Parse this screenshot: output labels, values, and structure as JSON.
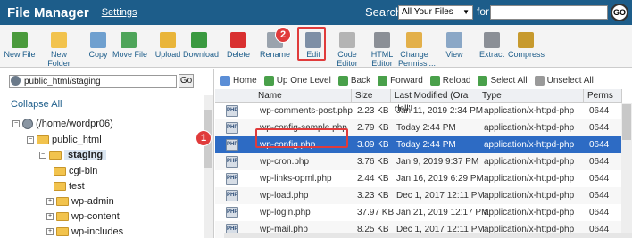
{
  "header": {
    "title": "File Manager",
    "settings": "Settings",
    "search_label": "Search",
    "search_scope": "All Your Files",
    "for_label": "for",
    "go": "GO"
  },
  "toolbar": [
    {
      "id": "new-file",
      "label": "New File",
      "color": "#4a9a3c"
    },
    {
      "id": "new-folder",
      "label": "New\nFolder",
      "color": "#f2c34d"
    },
    {
      "id": "copy",
      "label": "Copy",
      "color": "#6fa0cf"
    },
    {
      "id": "move-file",
      "label": "Move File",
      "color": "#4fa55a"
    },
    {
      "id": "upload",
      "label": "Upload",
      "color": "#e9b53a"
    },
    {
      "id": "download",
      "label": "Download",
      "color": "#3a9a40"
    },
    {
      "id": "delete",
      "label": "Delete",
      "color": "#d93030"
    },
    {
      "id": "rename",
      "label": "Rename",
      "color": "#9aa3ad"
    },
    {
      "id": "edit",
      "label": "Edit",
      "color": "#7e8fa6"
    },
    {
      "id": "code-editor",
      "label": "Code\nEditor",
      "color": "#b4b4b4"
    },
    {
      "id": "html-editor",
      "label": "HTML\nEditor",
      "color": "#8b8f96"
    },
    {
      "id": "change-permissions",
      "label": "Change\nPermissi...",
      "color": "#e3b04a"
    },
    {
      "id": "view",
      "label": "View",
      "color": "#8aa7c6"
    },
    {
      "id": "extract",
      "label": "Extract",
      "color": "#8b8f96"
    },
    {
      "id": "compress",
      "label": "Compress",
      "color": "#c79a2e"
    }
  ],
  "left": {
    "path": "public_html/staging",
    "go": "Go",
    "collapse_all": "Collapse All",
    "tree": [
      {
        "label": "(/home/wordpr06)",
        "toggle": "−"
      },
      {
        "label": "public_html",
        "toggle": "−"
      },
      {
        "label": "staging",
        "toggle": "−"
      },
      {
        "label": "cgi-bin",
        "toggle": ""
      },
      {
        "label": "test",
        "toggle": ""
      },
      {
        "label": "wp-admin",
        "toggle": "+"
      },
      {
        "label": "wp-content",
        "toggle": "+"
      },
      {
        "label": "wp-includes",
        "toggle": "+"
      }
    ]
  },
  "nav": [
    {
      "label": "Home",
      "color": "#5b8ed6"
    },
    {
      "label": "Up One Level",
      "color": "#49a04a"
    },
    {
      "label": "Back",
      "color": "#49a04a"
    },
    {
      "label": "Forward",
      "color": "#49a04a"
    },
    {
      "label": "Reload",
      "color": "#49a04a"
    },
    {
      "label": "Select All",
      "color": "#49a04a"
    },
    {
      "label": "Unselect All",
      "color": "#9a9a9a"
    }
  ],
  "columns": [
    "Name",
    "Size",
    "Last Modified (Ora dell'I",
    "Type",
    "Perms"
  ],
  "files": [
    {
      "name": "wp-comments-post.php",
      "size": "2.23 KB",
      "modified": "Jan 11, 2019 2:34 PM",
      "type": "application/x-httpd-php",
      "perms": "0644"
    },
    {
      "name": "wp-config-sample.php",
      "size": "2.79 KB",
      "modified": "Today 2:44 PM",
      "type": "application/x-httpd-php",
      "perms": "0644"
    },
    {
      "name": "wp-config.php",
      "size": "3.09 KB",
      "modified": "Today 2:44 PM",
      "type": "application/x-httpd-php",
      "perms": "0644"
    },
    {
      "name": "wp-cron.php",
      "size": "3.76 KB",
      "modified": "Jan 9, 2019 9:37 PM",
      "type": "application/x-httpd-php",
      "perms": "0644"
    },
    {
      "name": "wp-links-opml.php",
      "size": "2.44 KB",
      "modified": "Jan 16, 2019 6:29 PM",
      "type": "application/x-httpd-php",
      "perms": "0644"
    },
    {
      "name": "wp-load.php",
      "size": "3.23 KB",
      "modified": "Dec 1, 2017 12:11 PM",
      "type": "application/x-httpd-php",
      "perms": "0644"
    },
    {
      "name": "wp-login.php",
      "size": "37.97 KB",
      "modified": "Jan 21, 2019 12:17 PM",
      "type": "application/x-httpd-php",
      "perms": "0644"
    },
    {
      "name": "wp-mail.php",
      "size": "8.25 KB",
      "modified": "Dec 1, 2017 12:11 PM",
      "type": "application/x-httpd-php",
      "perms": "0644"
    }
  ],
  "file_icon_text": "PHP",
  "callouts": {
    "one": "1",
    "two": "2"
  },
  "colors": {
    "header": "#1d5d8a",
    "selection": "#2d6bc4",
    "callout": "#e03b3b"
  }
}
